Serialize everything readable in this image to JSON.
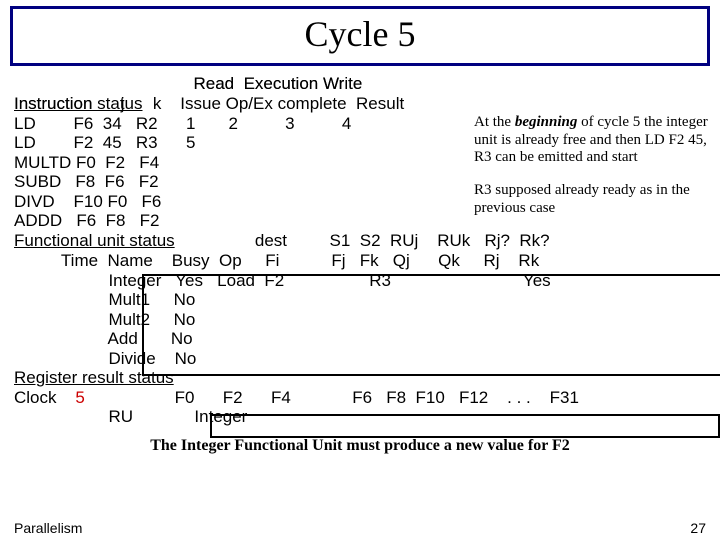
{
  "title": "Cycle 5",
  "instr_status_label": "Instruction status",
  "header1": "                                      Read  Execution Write",
  "header2": "Instruction      j      k    Issue Op/Ex complete  Result",
  "rows": {
    "ld1": "LD        F6  34   R2      1       2          3          4",
    "ld2": "LD        F2  45   R3      5",
    "multd": "MULTD F0  F2   F4",
    "subd": "SUBD   F8  F6   F2",
    "divd": "DIVD    F10 F0   F6",
    "addd": "ADDD   F6  F8   F2"
  },
  "fu_status_label": "Functional unit status",
  "fu_header1": "                                                   dest         S1  S2  RUj    RUk   Rj?  Rk?",
  "fu_header2": "          Time  Name    Busy  Op     Fi           Fj   Fk   Qj      Qk     Rj    Rk",
  "fu_rows": {
    "integer": "                    Integer   Yes   Load  F2                  R3                            Yes",
    "mult1": "                    Mult1     No",
    "mult2": "                    Mult2     No",
    "add": "                    Add       No",
    "divide": "                    Divide    No"
  },
  "reg_status_label": "Register result status",
  "reg_header": "Clock    5                   F0      F2      F4             F6   F8  F10   F12    . . .    F31",
  "reg_row": "                    RU             Integer",
  "note1_a": "At the ",
  "note1_b": "beginning",
  "note1_c": " of cycle 5 the integer unit is already free and then LD F2 45, R3 can be emitted and start",
  "note2": "R3 supposed already ready as in the previous case",
  "caption": "The Integer Functional Unit must produce a new value for F2",
  "footer_left": "Parallelism",
  "page_num": "27"
}
